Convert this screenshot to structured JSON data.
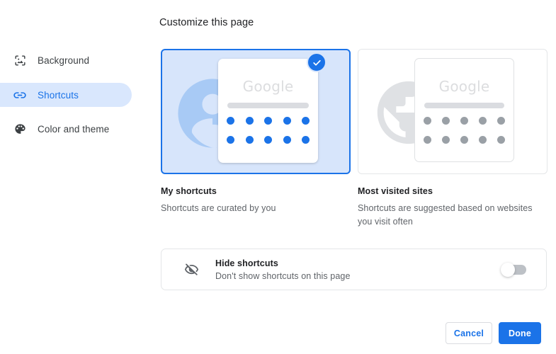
{
  "sidebar": {
    "items": [
      {
        "label": "Background",
        "icon": "image-icon",
        "selected": false
      },
      {
        "label": "Shortcuts",
        "icon": "link-icon",
        "selected": true
      },
      {
        "label": "Color and theme",
        "icon": "palette-icon",
        "selected": false
      }
    ]
  },
  "header": {
    "title": "Customize this page"
  },
  "options": [
    {
      "title": "My shortcuts",
      "description": "Shortcuts are curated by you",
      "selected": true,
      "preview": {
        "logo_text": "Google",
        "background_glyph": "person-icon",
        "dot_rows": 2,
        "dots_per_row": 5,
        "dot_color": "#1b73e8"
      }
    },
    {
      "title": "Most visited sites",
      "description": "Shortcuts are suggested based on websites you visit often",
      "selected": false,
      "preview": {
        "logo_text": "Google",
        "background_glyph": "globe-icon",
        "dot_rows": 2,
        "dots_per_row": 5,
        "dot_color": "#9aa0a6"
      }
    }
  ],
  "hide_shortcuts": {
    "icon": "eye-off-icon",
    "title": "Hide shortcuts",
    "description": "Don't show shortcuts on this page",
    "toggle_on": false
  },
  "footer": {
    "cancel_label": "Cancel",
    "done_label": "Done"
  },
  "colors": {
    "accent": "#1b73e8",
    "selected_card_fill": "#d7e5fb",
    "sidebar_selected_fill": "#d9e7fd",
    "muted_text": "#5f6368",
    "primary_text": "#202124",
    "border": "#e4e6e8",
    "toggle_track_off": "#bdc1c6"
  }
}
